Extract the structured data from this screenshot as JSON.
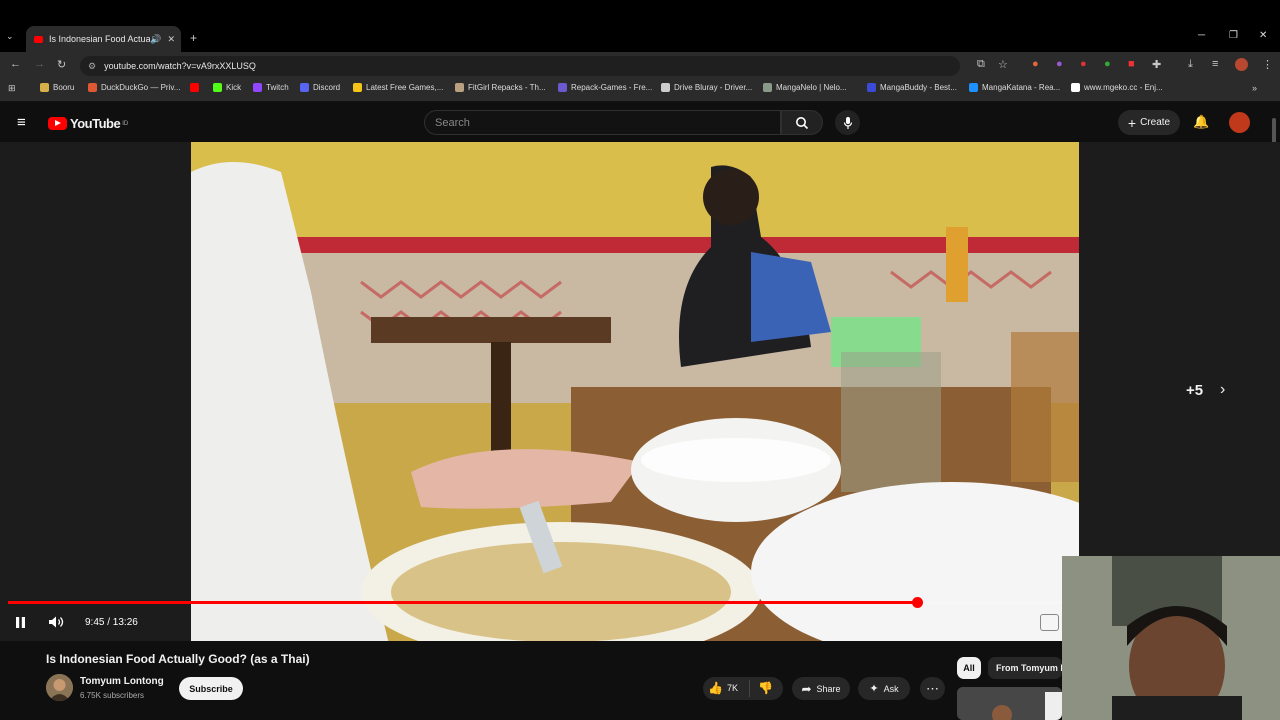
{
  "browser": {
    "tab_title": "Is Indonesian Food Actually",
    "url": "youtube.com/watch?v=vA9rxXXLUSQ",
    "bookmarks": [
      {
        "label": "Booru",
        "color": "#d8b04a"
      },
      {
        "label": "DuckDuckGo — Priv...",
        "color": "#de5833"
      },
      {
        "label": "",
        "color": "#ff0000"
      },
      {
        "label": "Kick",
        "color": "#53fc18"
      },
      {
        "label": "Twitch",
        "color": "#9146ff"
      },
      {
        "label": "Discord",
        "color": "#5865f2"
      },
      {
        "label": "Latest Free Games,...",
        "color": "#f5c518"
      },
      {
        "label": "FitGirl Repacks - Th...",
        "color": "#b8a080"
      },
      {
        "label": "Repack-Games - Fre...",
        "color": "#6a5acd"
      },
      {
        "label": "Drive Bluray - Driver...",
        "color": "#cccccc"
      },
      {
        "label": "MangaNelo | Nelo...",
        "color": "#8a9a8a"
      },
      {
        "label": "MangaBuddy - Best...",
        "color": "#3b4bd8"
      },
      {
        "label": "MangaKatana - Rea...",
        "color": "#1e90ff"
      },
      {
        "label": "www.mgeko.cc - Enj...",
        "color": "#ffffff"
      }
    ]
  },
  "youtube": {
    "logo_text": "YouTube",
    "logo_sup": "ID",
    "search_placeholder": "Search",
    "create_label": "Create"
  },
  "player": {
    "time": "9:45 / 13:26",
    "progress": 0.862,
    "overlay_count": "+5"
  },
  "video": {
    "title": "Is Indonesian Food Actually Good? (as a Thai)",
    "channel": "Tomyum Lontong",
    "subscribers": "6.75K subscribers",
    "subscribe_label": "Subscribe",
    "likes": "7K",
    "share_label": "Share",
    "ask_label": "Ask"
  },
  "chips": {
    "all": "All",
    "from_channel": "From Tomyum L"
  }
}
